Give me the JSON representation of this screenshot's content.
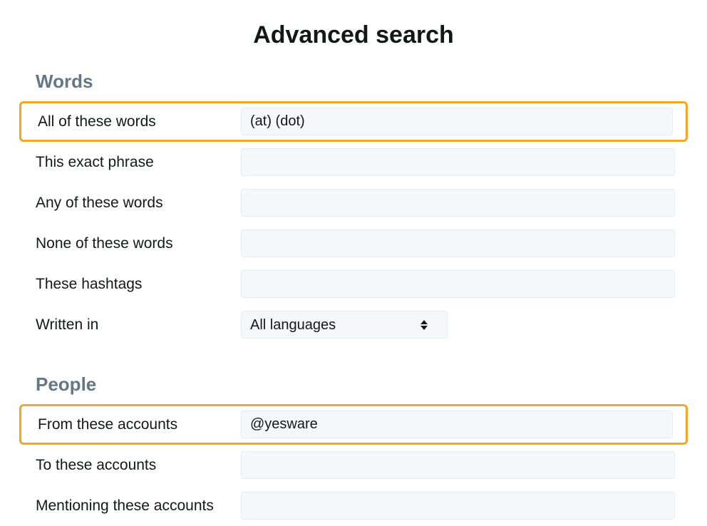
{
  "title": "Advanced search",
  "sections": {
    "words": {
      "heading": "Words",
      "fields": {
        "all_words": {
          "label": "All of these words",
          "value": "(at) (dot)"
        },
        "exact_phrase": {
          "label": "This exact phrase",
          "value": ""
        },
        "any_words": {
          "label": "Any of these words",
          "value": ""
        },
        "none_words": {
          "label": "None of these words",
          "value": ""
        },
        "hashtags": {
          "label": "These hashtags",
          "value": ""
        },
        "written_in": {
          "label": "Written in",
          "value": "All languages"
        }
      }
    },
    "people": {
      "heading": "People",
      "fields": {
        "from_accounts": {
          "label": "From these accounts",
          "value": "@yesware"
        },
        "to_accounts": {
          "label": "To these accounts",
          "value": ""
        },
        "mentioning": {
          "label": "Mentioning these accounts",
          "value": ""
        }
      }
    }
  }
}
